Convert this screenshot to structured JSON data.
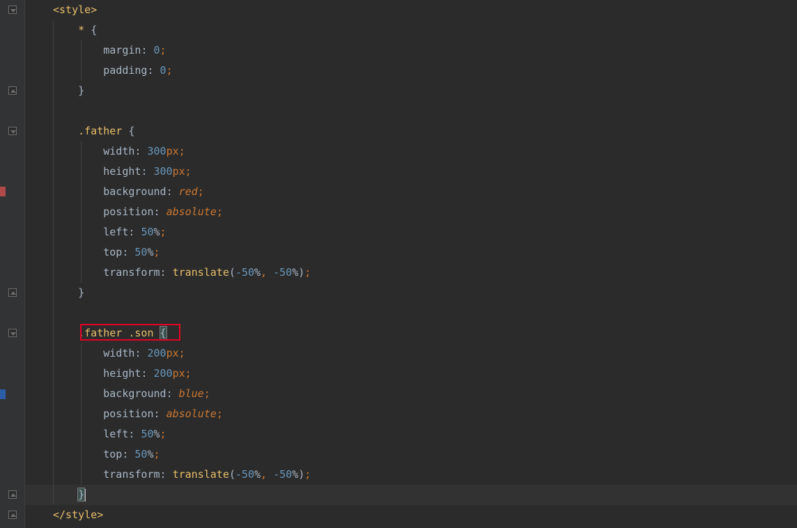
{
  "code": {
    "openStyleTag": "<style>",
    "closeStyleTag": "</style>",
    "starSelector": "*",
    "openBrace": "{",
    "closeBrace": "}",
    "margin": "margin",
    "padding": "padding",
    "width": "width",
    "height": "height",
    "background": "background",
    "position": "position",
    "left": "left",
    "top": "top",
    "transform": "transform",
    "zero": "0",
    "px300": "300",
    "px200": "200",
    "pxUnit": "px",
    "pctUnit": "%",
    "fifty": "50",
    "negFifty": "-50",
    "red": "red",
    "blue": "blue",
    "absolute": "absolute",
    "translate": "translate",
    "fatherSel": ".father",
    "sonSel": ".son",
    "comma": ",",
    "colon": ":",
    "semi": ";",
    "lp": "(",
    "rp": ")"
  },
  "annotations": {
    "highlightedSelector": ".father .son"
  },
  "gutterMarks": {
    "redLine": 10,
    "blueLine": 20
  },
  "colors": {
    "redMark": "#b04a4a",
    "blueMark": "#2c5ea8"
  }
}
